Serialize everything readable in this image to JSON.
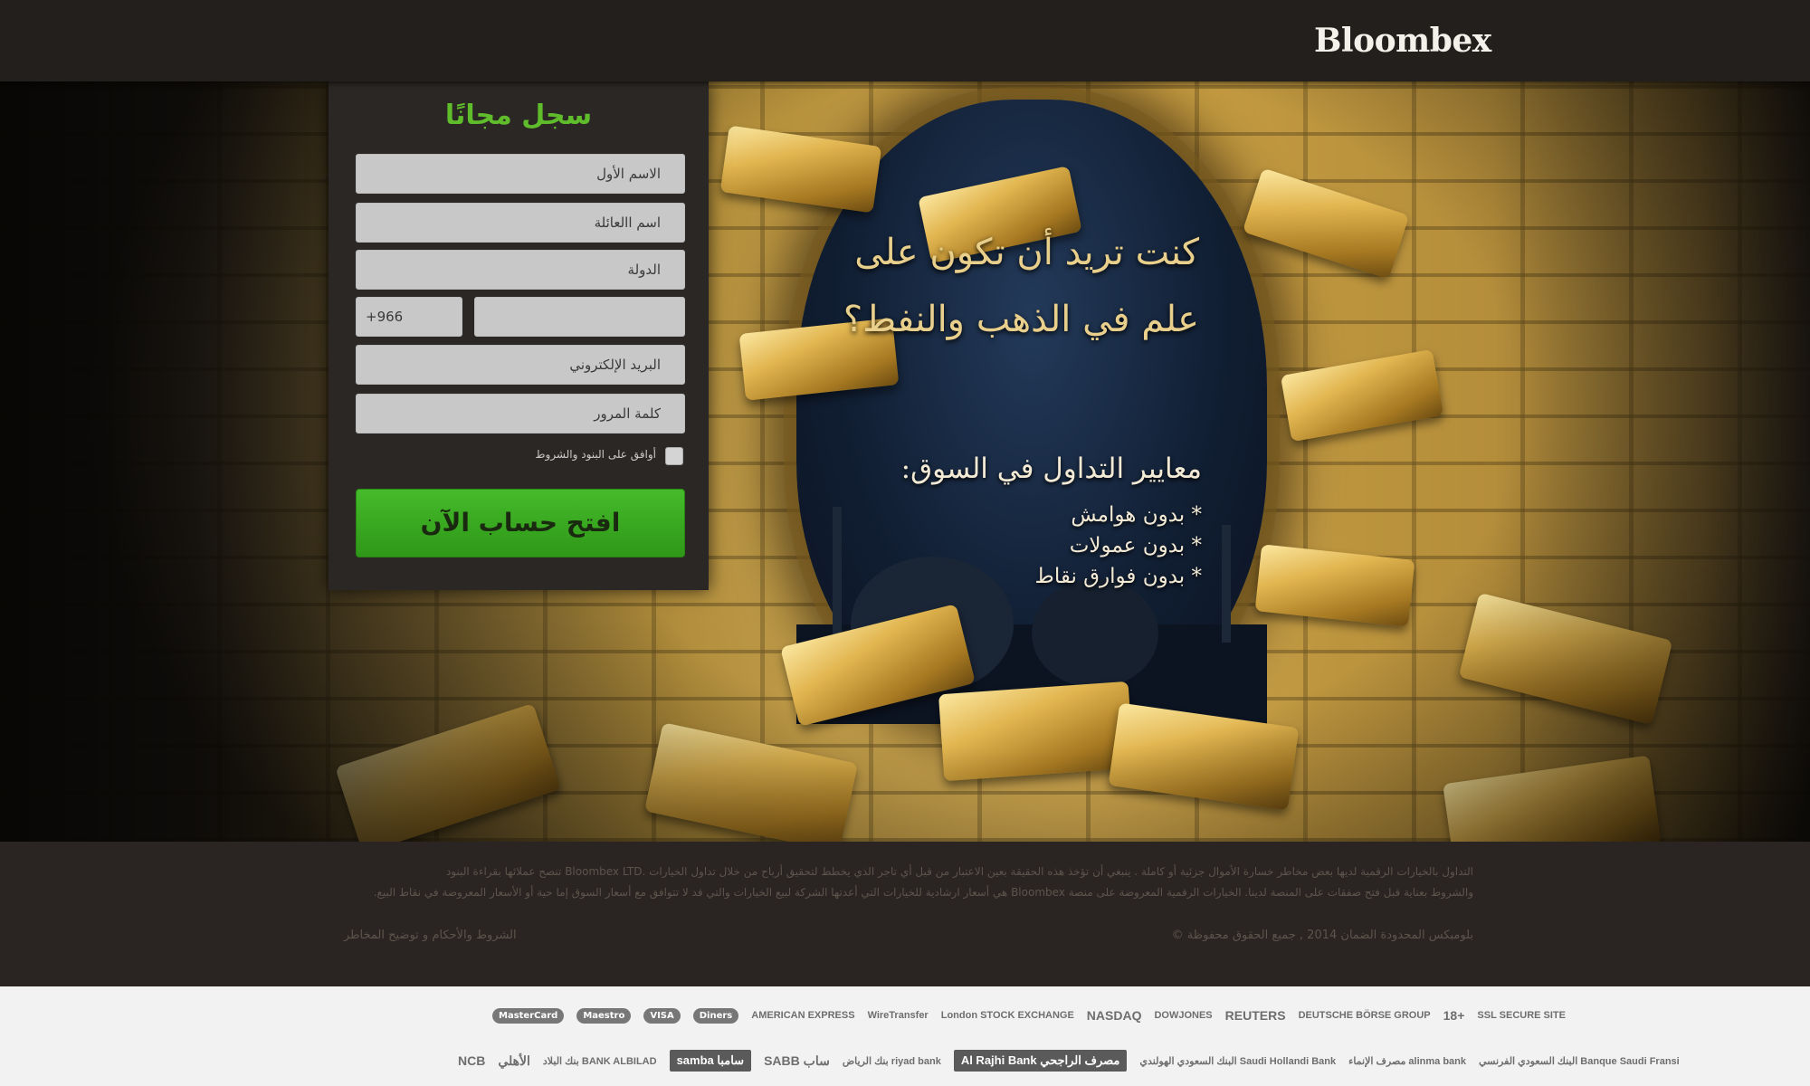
{
  "header": {
    "logo": "Bloombex"
  },
  "form": {
    "title": "سجل مجانًا",
    "first_name_placeholder": "الاسم الأول",
    "last_name_placeholder": "اسم االعائلة",
    "country_placeholder": "الدولة",
    "phone_code": "+966",
    "email_placeholder": "البريد الإلكتروني",
    "password_placeholder": "كلمة المرور",
    "terms_label": "أوافق على البنود والشروط",
    "submit_label": "افتح حساب الآن"
  },
  "hero": {
    "headline_line1": "كنت تريد أن تكون على",
    "headline_line2": "علم في الذهب والنفط؟",
    "subheading": "معايير التداول في السوق:",
    "bullets": [
      "بدون هوامش",
      "بدون عمولات",
      "بدون فوارق نقاط"
    ]
  },
  "disclaimer": {
    "line1": "التداول بالخيارات الرقمية لديها بعض مخاطر خسارة الأموال جزئية أو كاملة . ينبغي أن تؤخذ هذه الحقيقة بعين الاعتبار من قبل أي تاجر الذي يخطط لتحقيق أرباح من خلال تداول الخيارات .Bloombex LTD تنصح عملائها بقراءة البنود",
    "line2": "والشروط بعناية قبل فتح صفقات على المنصة لدينا. الخيارات الرقمية المعروضة على منصة Bloombex هي أسعار ارشادية للخيارات التي أعدتها الشركة لبيع الخيارات والتي قد لا تتوافق مع أسعار السوق إما حية أو الأسعار المعروضة في نقاط البيع.",
    "copyright": "بلومبكس المحدودة الضمان 2014 , جميع الحقوق محفوظة ©",
    "terms_link": "الشروط والأحكام و توضيح المخاطر"
  },
  "partners_row1": [
    "MasterCard",
    "Maestro",
    "VISA",
    "Diners",
    "AMERICAN EXPRESS",
    "WireTransfer",
    "London STOCK EXCHANGE",
    "NASDAQ",
    "DOWJONES",
    "REUTERS",
    "DEUTSCHE BÖRSE GROUP",
    "18+",
    "SSL SECURE SITE"
  ],
  "partners_row2": [
    "NCB",
    "الأهلي",
    "بنك البلاد BANK ALBILAD",
    "samba سامبا",
    "SABB ساب",
    "بنك الرياض riyad bank",
    "Al Rajhi Bank مصرف الراجحي",
    "البنك السعودي الهولندي Saudi Hollandi Bank",
    "مصرف الإنماء alinma bank",
    "البنك السعودي الفرنسي Banque Saudi Fransi"
  ]
}
